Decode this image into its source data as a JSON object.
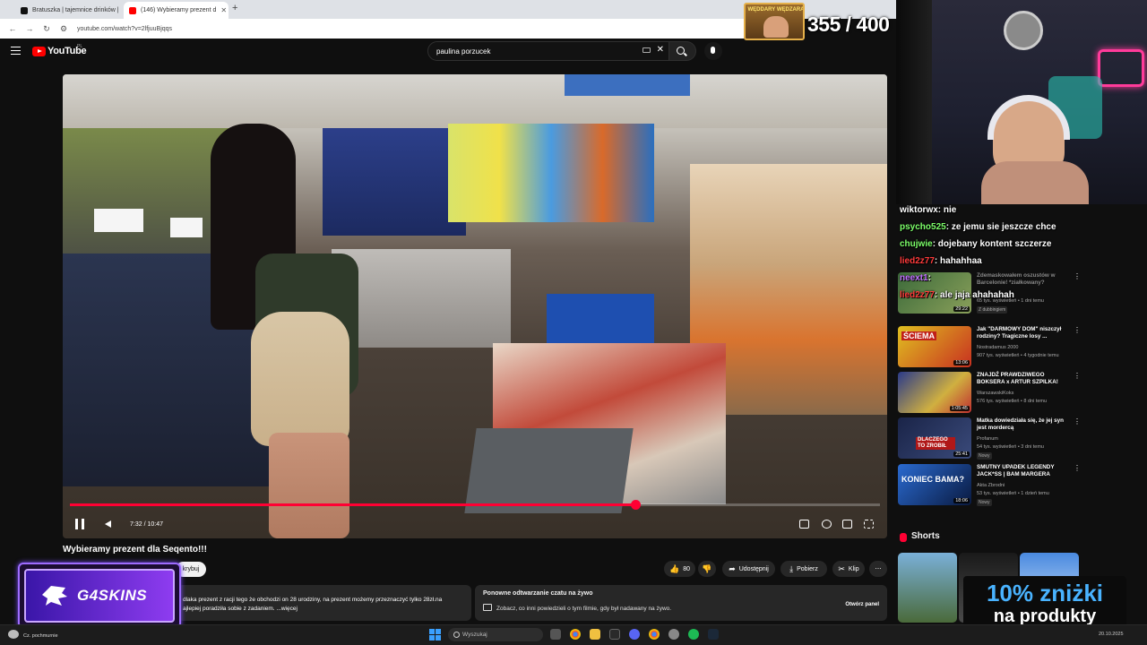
{
  "browser": {
    "tabs": [
      {
        "title": "Bratuszka | tajemnice drinków |",
        "active": false
      },
      {
        "title": "(146) Wybieramy prezent d",
        "active": true
      }
    ],
    "new_tab": "+",
    "url": "youtube.com/watch?v=2lfjuuBjqqs"
  },
  "youtube": {
    "logo_text": "YouTube",
    "region": "PL",
    "search_value": "paulina porzucek",
    "player": {
      "timecode": "7:32 / 10:47",
      "progress": 0.698
    },
    "video_title": "Wybieramy prezent dla Seqento!!!",
    "subscribe_label": "krybuj",
    "actions": {
      "likes": "80",
      "share": "Udostępnij",
      "download": "Pobierz",
      "clip": "Klip",
      "more": "⋯"
    },
    "description": {
      "line1": "dlaka prezent z racji tego że obchodzi on 28 urodziny, na prezent możemy przeznaczyć tylko 28zł.na",
      "line2": "ajlepiej poradziła sobie z zadaniem. ...więcej"
    },
    "chat_replay": {
      "title": "Ponowne odtwarzanie czatu na żywo",
      "desc": "Zobacz, co inni powiedzieli o tym filmie, gdy był nadawany na żywo.",
      "button": "Otwórz panel"
    },
    "recommendations": [
      {
        "title": "Zdemaskowałem oszustów w Barcelonie! *ziałkowany?",
        "channel": "",
        "meta": "65 tys. wyświetleń • 1 dni temu",
        "badge": "Z dubbingiem",
        "duration": "29:22"
      },
      {
        "title": "Jak \"DARMOWY DOM\" niszczył rodziny? Tragiczne losy ...",
        "channel": "Nostradamus 2000",
        "meta": "907 tys. wyświetleń • 4 tygodnie temu",
        "badge": "",
        "duration": "13:06"
      },
      {
        "title": "ZNAJDŹ PRAWDZIWEGO BOKSERA x ARTUR SZPILKA!",
        "channel": "WarszawskiKoks",
        "meta": "576 tys. wyświetleń • 8 dni temu",
        "badge": "",
        "duration": "1:05:45"
      },
      {
        "title": "Matka dowiedziała się, że jej syn jest mordercą",
        "channel": "Profanum",
        "meta": "54 tys. wyświetleń • 3 dni temu",
        "badge": "Nowy",
        "duration": "25:41"
      },
      {
        "title": "SMUTNY UPADEK LEGENDY JACK*SS | BAM MARGERA",
        "channel": "Akta Zbrodni",
        "meta": "53 tys. wyświetleń • 1 dzień temu",
        "badge": "Nowy",
        "duration": "18:06"
      }
    ],
    "thumb_text": {
      "sciema": "ŚCIEMA",
      "dlaczego": "DLACZEGO TO ZROBIŁ",
      "koniec": "KONIEC BAMA?"
    },
    "shorts_title": "Shorts"
  },
  "stream": {
    "counter_label": "WĘDDARY WĘDZARA",
    "counter": "355 / 400",
    "chat": [
      {
        "user": "wiktorwx",
        "color": "#ffffff",
        "msg": "nie"
      },
      {
        "user": "psycho525",
        "color": "#7dff6a",
        "msg": "ze jemu sie jeszcze chce"
      },
      {
        "user": "chujwie",
        "color": "#7dff6a",
        "msg": "dojebany kontent szczerze"
      },
      {
        "user": "lied2z77",
        "color": "#ff3b3b",
        "msg": "hahahhaa"
      },
      {
        "user": "neext1",
        "color": "#c070ff",
        "msg": ""
      },
      {
        "user": "lied2z77",
        "color": "#ff3b3b",
        "msg": "ale jaja ahahahah"
      }
    ],
    "sponsor_text": "G4SKINS",
    "promo_line1": "10% zniżki",
    "promo_line2": "na produkty"
  },
  "taskbar": {
    "weather": "Cz. pochmurnie",
    "search_placeholder": "Wyszukaj",
    "clock": "20.10.2025"
  },
  "colors": {
    "accent": "#ff0033",
    "youtube_red": "#ff0000",
    "dark_bg": "#0f0f0f"
  }
}
